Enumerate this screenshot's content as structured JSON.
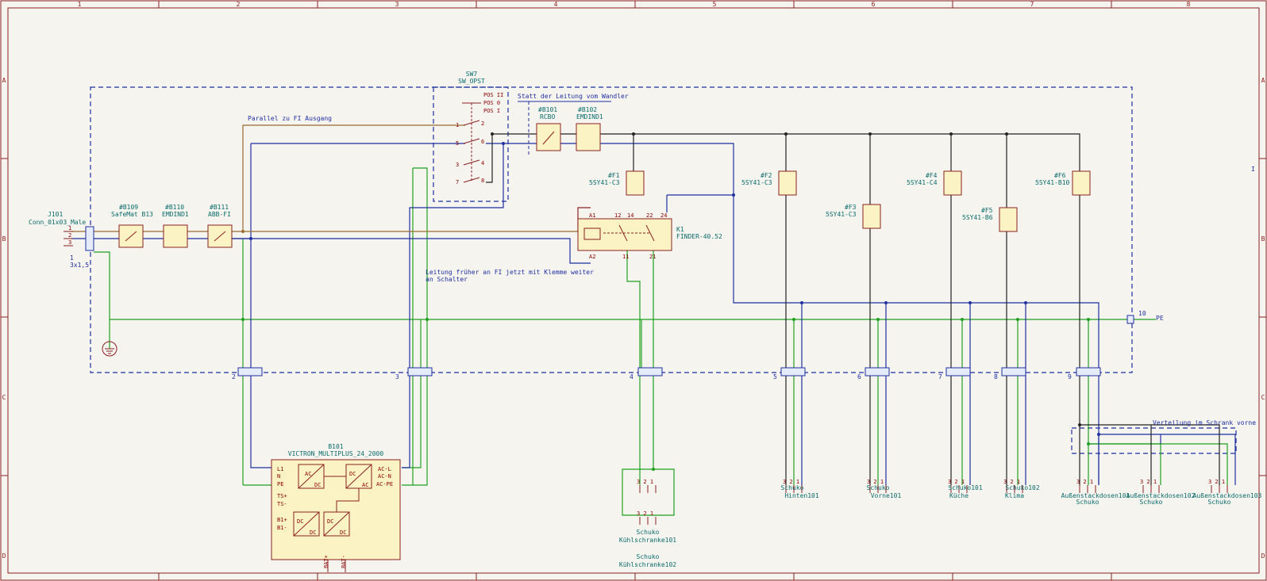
{
  "frame": {
    "cols": [
      "1",
      "2",
      "3",
      "4",
      "5",
      "6",
      "7",
      "8"
    ],
    "rows": [
      "A",
      "B",
      "C",
      "D"
    ]
  },
  "j101": {
    "ref": "J101",
    "value": "Conn_01x03_Male",
    "pins": [
      "1",
      "2",
      "3"
    ]
  },
  "terminals": {
    "t1": "1",
    "cable": "3x1,5",
    "t2": "2",
    "t3": "3",
    "t4": "4",
    "t5": "5",
    "t6": "6",
    "t7": "7",
    "t8": "8",
    "t9": "9",
    "t10": "10",
    "pe": "PE"
  },
  "devices": {
    "b109": {
      "ref": "#B109",
      "value": "SafeMat B13"
    },
    "b110": {
      "ref": "#B110",
      "value": "EMDIND1"
    },
    "b111": {
      "ref": "#B111",
      "value": "ABB-FI"
    },
    "b101": {
      "ref": "#B101",
      "value": "RCBO"
    },
    "b102": {
      "ref": "#B102",
      "value": "EMDIND1"
    }
  },
  "sw7": {
    "ref": "SW7",
    "value": "SW_OPST",
    "positions": [
      "POS II",
      "POS 0",
      "POS I"
    ],
    "pins": [
      "1",
      "2",
      "5",
      "6",
      "3",
      "4",
      "7",
      "8"
    ]
  },
  "breakers": [
    {
      "ref": "#F1",
      "value": "5SY41-C3"
    },
    {
      "ref": "#F2",
      "value": "5SY41-C3"
    },
    {
      "ref": "#F3",
      "value": "5SY41-C3"
    },
    {
      "ref": "#F4",
      "value": "5SY41-C4"
    },
    {
      "ref": "#F5",
      "value": "5SY41-B6"
    },
    {
      "ref": "#F6",
      "value": "5SY41-B10"
    }
  ],
  "relay": {
    "ref": "K1",
    "value": "FINDER-40.52",
    "pins": [
      "A1",
      "A2",
      "12",
      "14",
      "22",
      "24",
      "11",
      "21"
    ]
  },
  "inverter": {
    "ref": "B101",
    "value": "VICTRON_MULTIPLUS_24_2000",
    "left_pins": [
      "L1",
      "N",
      "PE",
      "TS+",
      "TS-",
      "B1+",
      "B1-"
    ],
    "right_pins": [
      "AC-L",
      "AC-N",
      "AC-PE"
    ],
    "bottom_pins": [
      "BAT+",
      "BAT-"
    ],
    "blocks": [
      "AC",
      "DC"
    ]
  },
  "sockets": {
    "pins": "3 2 1",
    "items": [
      {
        "type": "Schuko",
        "name": "Kühlschranke101"
      },
      {
        "type": "Schuko",
        "name": "Kühlschranke102"
      },
      {
        "type": "Schuko",
        "name": "Hinten101"
      },
      {
        "type": "Schuko",
        "name": "Vorne101"
      },
      {
        "type": "Schuko101",
        "name": "Küche"
      },
      {
        "type": "Schuko102",
        "name": "Klima"
      },
      {
        "type": "Schuko",
        "name": "Außenstackdosen101"
      },
      {
        "type": "Schuko",
        "name": "Außenstackdosen102"
      },
      {
        "type": "Schuko",
        "name": "Außenstackdosen103"
      }
    ]
  },
  "notes": {
    "parallel": "Parallel zu FI Ausgang",
    "wandler": "Statt der Leitung vom Wandler",
    "leitung_1": "Leitung früher an FI jetzt mit Klemme weiter",
    "leitung_2": "an Schalter",
    "verteilung": "Verteilung im Schrank vorne",
    "stray": "I"
  }
}
